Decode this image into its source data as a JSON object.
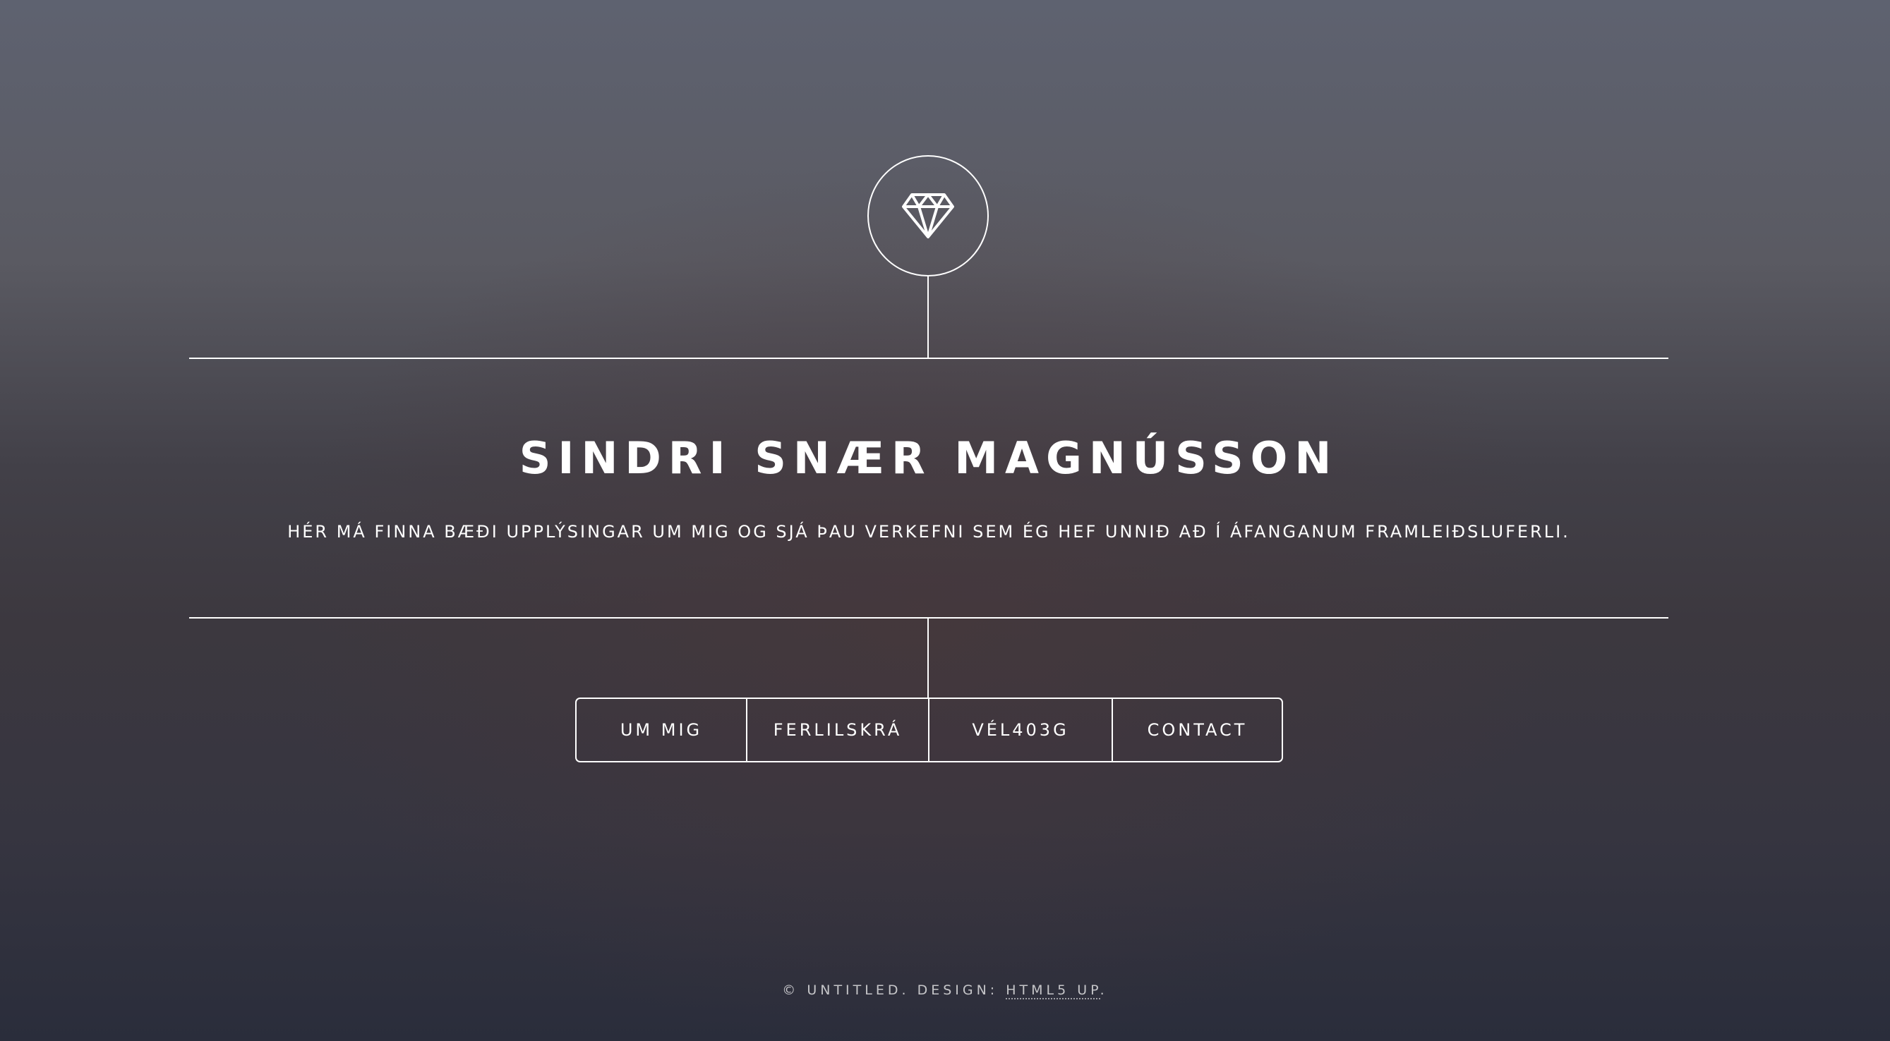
{
  "header": {
    "logo_icon": "diamond-icon",
    "title": "SINDRI SNÆR MAGNÚSSON",
    "subtitle": "HÉR MÁ FINNA BÆÐI UPPLÝSINGAR UM MIG OG SJÁ ÞAU VERKEFNI SEM ÉG HEF UNNIÐ AÐ Í ÁFANGANUM FRAMLEIÐSLUFERLI."
  },
  "nav": {
    "items": [
      {
        "label": "UM MIG"
      },
      {
        "label": "FERLILSKRÁ"
      },
      {
        "label": "VÉL403G"
      },
      {
        "label": "CONTACT"
      }
    ]
  },
  "footer": {
    "copyright": "© UNTITLED. DESIGN: ",
    "link_label": "HTML5 UP",
    "suffix": "."
  },
  "colors": {
    "foreground": "#ffffff",
    "background_top": "#5e6270",
    "background_bottom": "#2a2d3b"
  }
}
